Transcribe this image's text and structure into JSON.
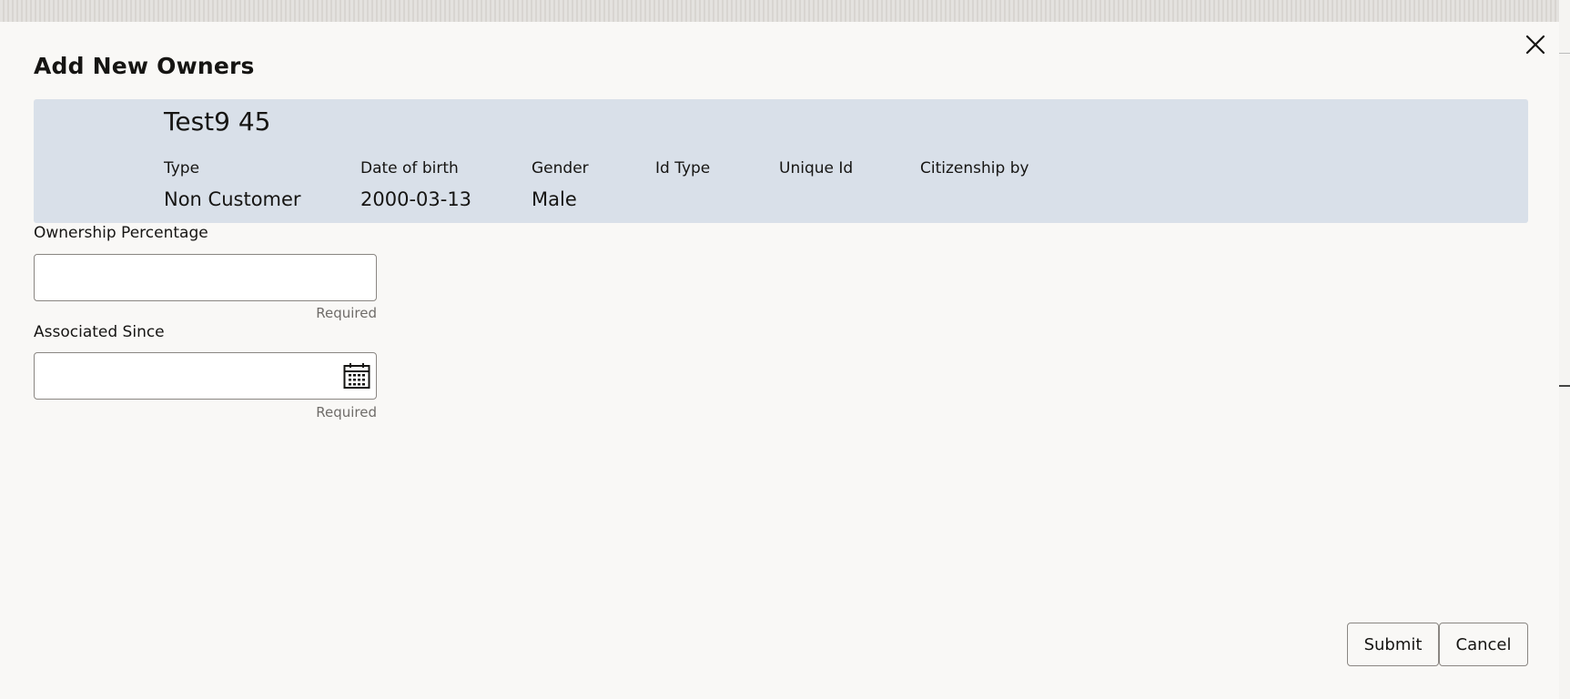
{
  "dialog": {
    "title": "Add New Owners"
  },
  "owner": {
    "name": "Test9 45",
    "fields": [
      {
        "label": "Type",
        "value": "Non Customer"
      },
      {
        "label": "Date of birth",
        "value": "2000-03-13"
      },
      {
        "label": "Gender",
        "value": "Male"
      },
      {
        "label": "Id Type",
        "value": ""
      },
      {
        "label": "Unique Id",
        "value": ""
      },
      {
        "label": "Citizenship by",
        "value": ""
      }
    ]
  },
  "form": {
    "ownership_percentage": {
      "label": "Ownership Percentage",
      "value": "",
      "helper": "Required"
    },
    "associated_since": {
      "label": "Associated Since",
      "value": "",
      "helper": "Required",
      "icon": "calendar-icon"
    }
  },
  "actions": {
    "submit_label": "Submit",
    "cancel_label": "Cancel"
  },
  "colors": {
    "summary_background": "#d9e0e9",
    "dialog_background": "#f9f8f6",
    "input_border": "#8a8682"
  }
}
